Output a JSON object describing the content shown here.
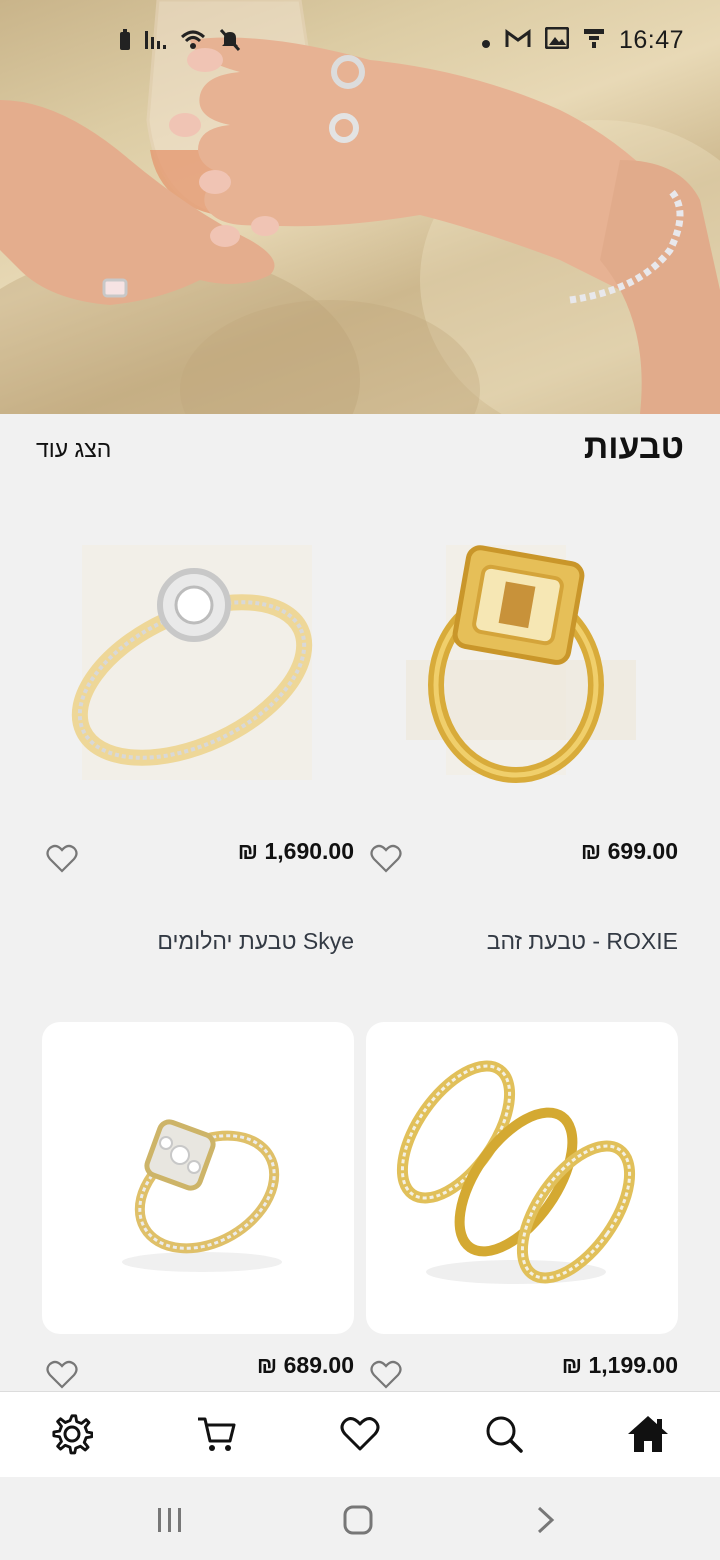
{
  "status_bar": {
    "time": "16:47",
    "left_icons": [
      "battery-icon",
      "signal-icon",
      "wifi-icon",
      "mute-icon"
    ],
    "right_icons": [
      "dot-icon",
      "gmail-icon",
      "gallery-icon",
      "notification-icon"
    ]
  },
  "hero": {
    "image": "hands-with-rings-and-wine-glass"
  },
  "section": {
    "title": "טבעות",
    "show_more": "הצג עוד"
  },
  "products": [
    {
      "price": "₪ 699.00",
      "name": "טבעת זהב - ROXIE",
      "image": "gold-rectangle-pave-ring"
    },
    {
      "price": "₪ 1,690.00",
      "name": "טבעת יהלומים Skye",
      "image": "halo-diamond-ring"
    },
    {
      "price": "₪ 1,199.00",
      "name": "",
      "image": "triple-oval-gold-ring"
    },
    {
      "price": "₪ 689.00",
      "name": "",
      "image": "cluster-diamond-ring"
    }
  ],
  "bottom_nav": [
    "home-icon",
    "search-icon",
    "heart-icon",
    "cart-icon",
    "settings-icon"
  ],
  "colors": {
    "background": "#f1f1f1",
    "nav_bg": "#ffffff",
    "text": "#111111",
    "name_text": "#333a44"
  }
}
